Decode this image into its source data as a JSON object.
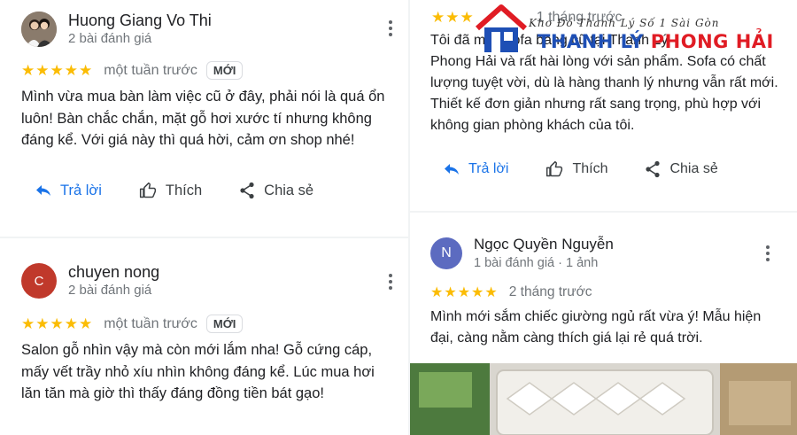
{
  "reviews_left": [
    {
      "name": "Huong Giang Vo Thi",
      "meta": "2 bài đánh giá",
      "stars": "★★★★★",
      "when": "một tuần trước",
      "badge": "MỚI",
      "text": [
        "Mình vừa mua bàn làm việc cũ ở đây, phải nói là quá ổn",
        "luôn! Bàn chắc chắn, mặt gỗ hơi xước tí nhưng không",
        "đáng kể. Với giá này thì quá hời, cảm ơn shop nhé!"
      ]
    },
    {
      "name": "chuyen nong",
      "avatar_letter": "C",
      "avatar_color": "#c0392b",
      "meta": "2 bài đánh giá",
      "stars": "★★★★★",
      "when": "một tuần trước",
      "badge": "MỚI",
      "text": [
        "Salon gỗ nhìn vậy mà còn mới lắm nha! Gỗ cứng cáp,",
        "mấy vết trầy nhỏ xíu nhìn không đáng kể. Lúc mua hơi",
        "lăn tăn mà giờ thì thấy đáng đồng tiền bát gạo!"
      ]
    }
  ],
  "reviews_right": [
    {
      "stars": "★★★",
      "when": "1 tháng trước",
      "text": [
        "Tôi đã mua sofa băng cũ tại Thanh Lý",
        "Phong Hải và rất hài lòng với sản phẩm. Sofa có chất",
        "lượng tuyệt vời, dù là hàng thanh lý nhưng vẫn rất mới.",
        "Thiết kế đơn giản nhưng rất sang trọng, phù hợp với",
        "không gian phòng khách của tôi."
      ]
    },
    {
      "name": "Ngọc Quyền Nguyễn",
      "avatar_letter": "N",
      "avatar_color": "#5c6bc0",
      "meta": "1 bài đánh giá · 1 ảnh",
      "stars": "★★★★★",
      "when": "2 tháng trước",
      "text": [
        "Mình mới sắm chiếc giường ngủ rất vừa ý! Mẫu hiện",
        "đại, càng nằm càng thích giá lại rẻ quá trời."
      ]
    }
  ],
  "actions": {
    "reply": "Trả lời",
    "like": "Thích",
    "share": "Chia sẻ"
  },
  "logo": {
    "slogan": "Kho Đồ Thanh Lý Số 1 Sài Gòn",
    "title_blue": "THANH LÝ",
    "title_red": "PHONG HẢI"
  },
  "colors": {
    "star": "#fbbc04",
    "reply": "#1a73e8",
    "logo_blue": "#1e4fb5",
    "logo_red": "#e01c24"
  }
}
